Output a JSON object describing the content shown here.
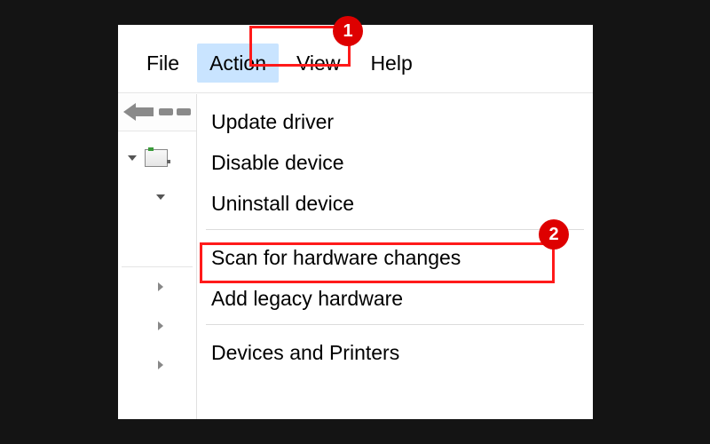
{
  "menubar": {
    "file": "File",
    "action": "Action",
    "view": "View",
    "help": "Help"
  },
  "callouts": {
    "one": "1",
    "two": "2"
  },
  "menu": {
    "update": "Update driver",
    "disable": "Disable device",
    "uninstall": "Uninstall device",
    "scan": "Scan for hardware changes",
    "legacy": "Add legacy hardware",
    "devices": "Devices and Printers"
  }
}
